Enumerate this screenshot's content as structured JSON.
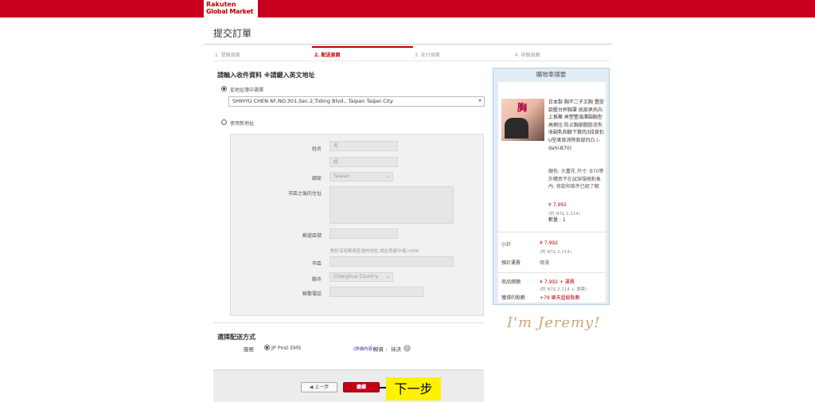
{
  "brand": {
    "line1": "Rakuten",
    "line2": "Global Market"
  },
  "page": {
    "title": "提交訂單"
  },
  "steps": [
    {
      "label": "1. 登錄頁面"
    },
    {
      "label": "2. 配送頁面"
    },
    {
      "label": "3. 支付頁面"
    },
    {
      "label": "4. 核驗頁面"
    }
  ],
  "address": {
    "heading": "請輸入收件資料 ※請鍵入英文地址",
    "option_book": "從地址簿中選擇",
    "selected_address": "SHIHYU CHEN 6F,NO.301,Sec.2,Tiding Blvd., Taipan Taipei City",
    "option_new": "使用新地址",
    "fields": {
      "name_label": "姓名",
      "first_placeholder": "名",
      "last_placeholder": "姓",
      "country_label": "國家",
      "country_value": "Taiwan",
      "address_label": "市區之後的住址",
      "postal_label": "郵遞區號",
      "postal_note": "對於沒有郵政區號的地址,請在系統中填入000",
      "city_label": "市區",
      "county_label": "縣市",
      "county_value": "Changhua Country",
      "phone_label": "聯繫電話"
    }
  },
  "shipping": {
    "heading": "選擇配送方式",
    "method_label": "服務",
    "method_value": "JP Post EMS",
    "detail_link": "(詳細內容)",
    "fee_label": "郵資 :",
    "fee_value": "待決",
    "help": "?"
  },
  "buttons": {
    "prev": "◀ 上一步",
    "next": "繼續"
  },
  "annotation": {
    "next_step": "下一步"
  },
  "watermark": "I'm Jeremy!",
  "cart": {
    "title": "購物車摘要",
    "thumb_text": "胸",
    "product_desc": "日本製 胸不二子文胸 豐挺款壓台杯胸罩 底部承托向上推聚 再塑豐滿澤圓胸型 高側比 防止胸部脂肪流失收副乳和腋下贅肉3段背扣U型美背消除背部凹凸 (-dahl-B70)",
    "product_options": "顏色: 大薑花 尺寸: B70等外購買不在試穿服務對象內: 修款和條件已經了解",
    "price": "¥ 7,992",
    "price_twd": "(約 NT$ 2,114)",
    "qty": "數量 : 1",
    "subtotal_label": "小計",
    "subtotal": "¥ 7,992",
    "subtotal_twd": "(約 NT$ 2,114)",
    "shipping_label": "預計運費",
    "shipping_value": "待決",
    "total_label": "商品總額",
    "total": "¥ 7,992 + 運費",
    "total_twd": "(約 NT$ 2,114 + 運費)",
    "points_label": "獲得的點數",
    "points_value": "+79 樂天超級點數"
  }
}
